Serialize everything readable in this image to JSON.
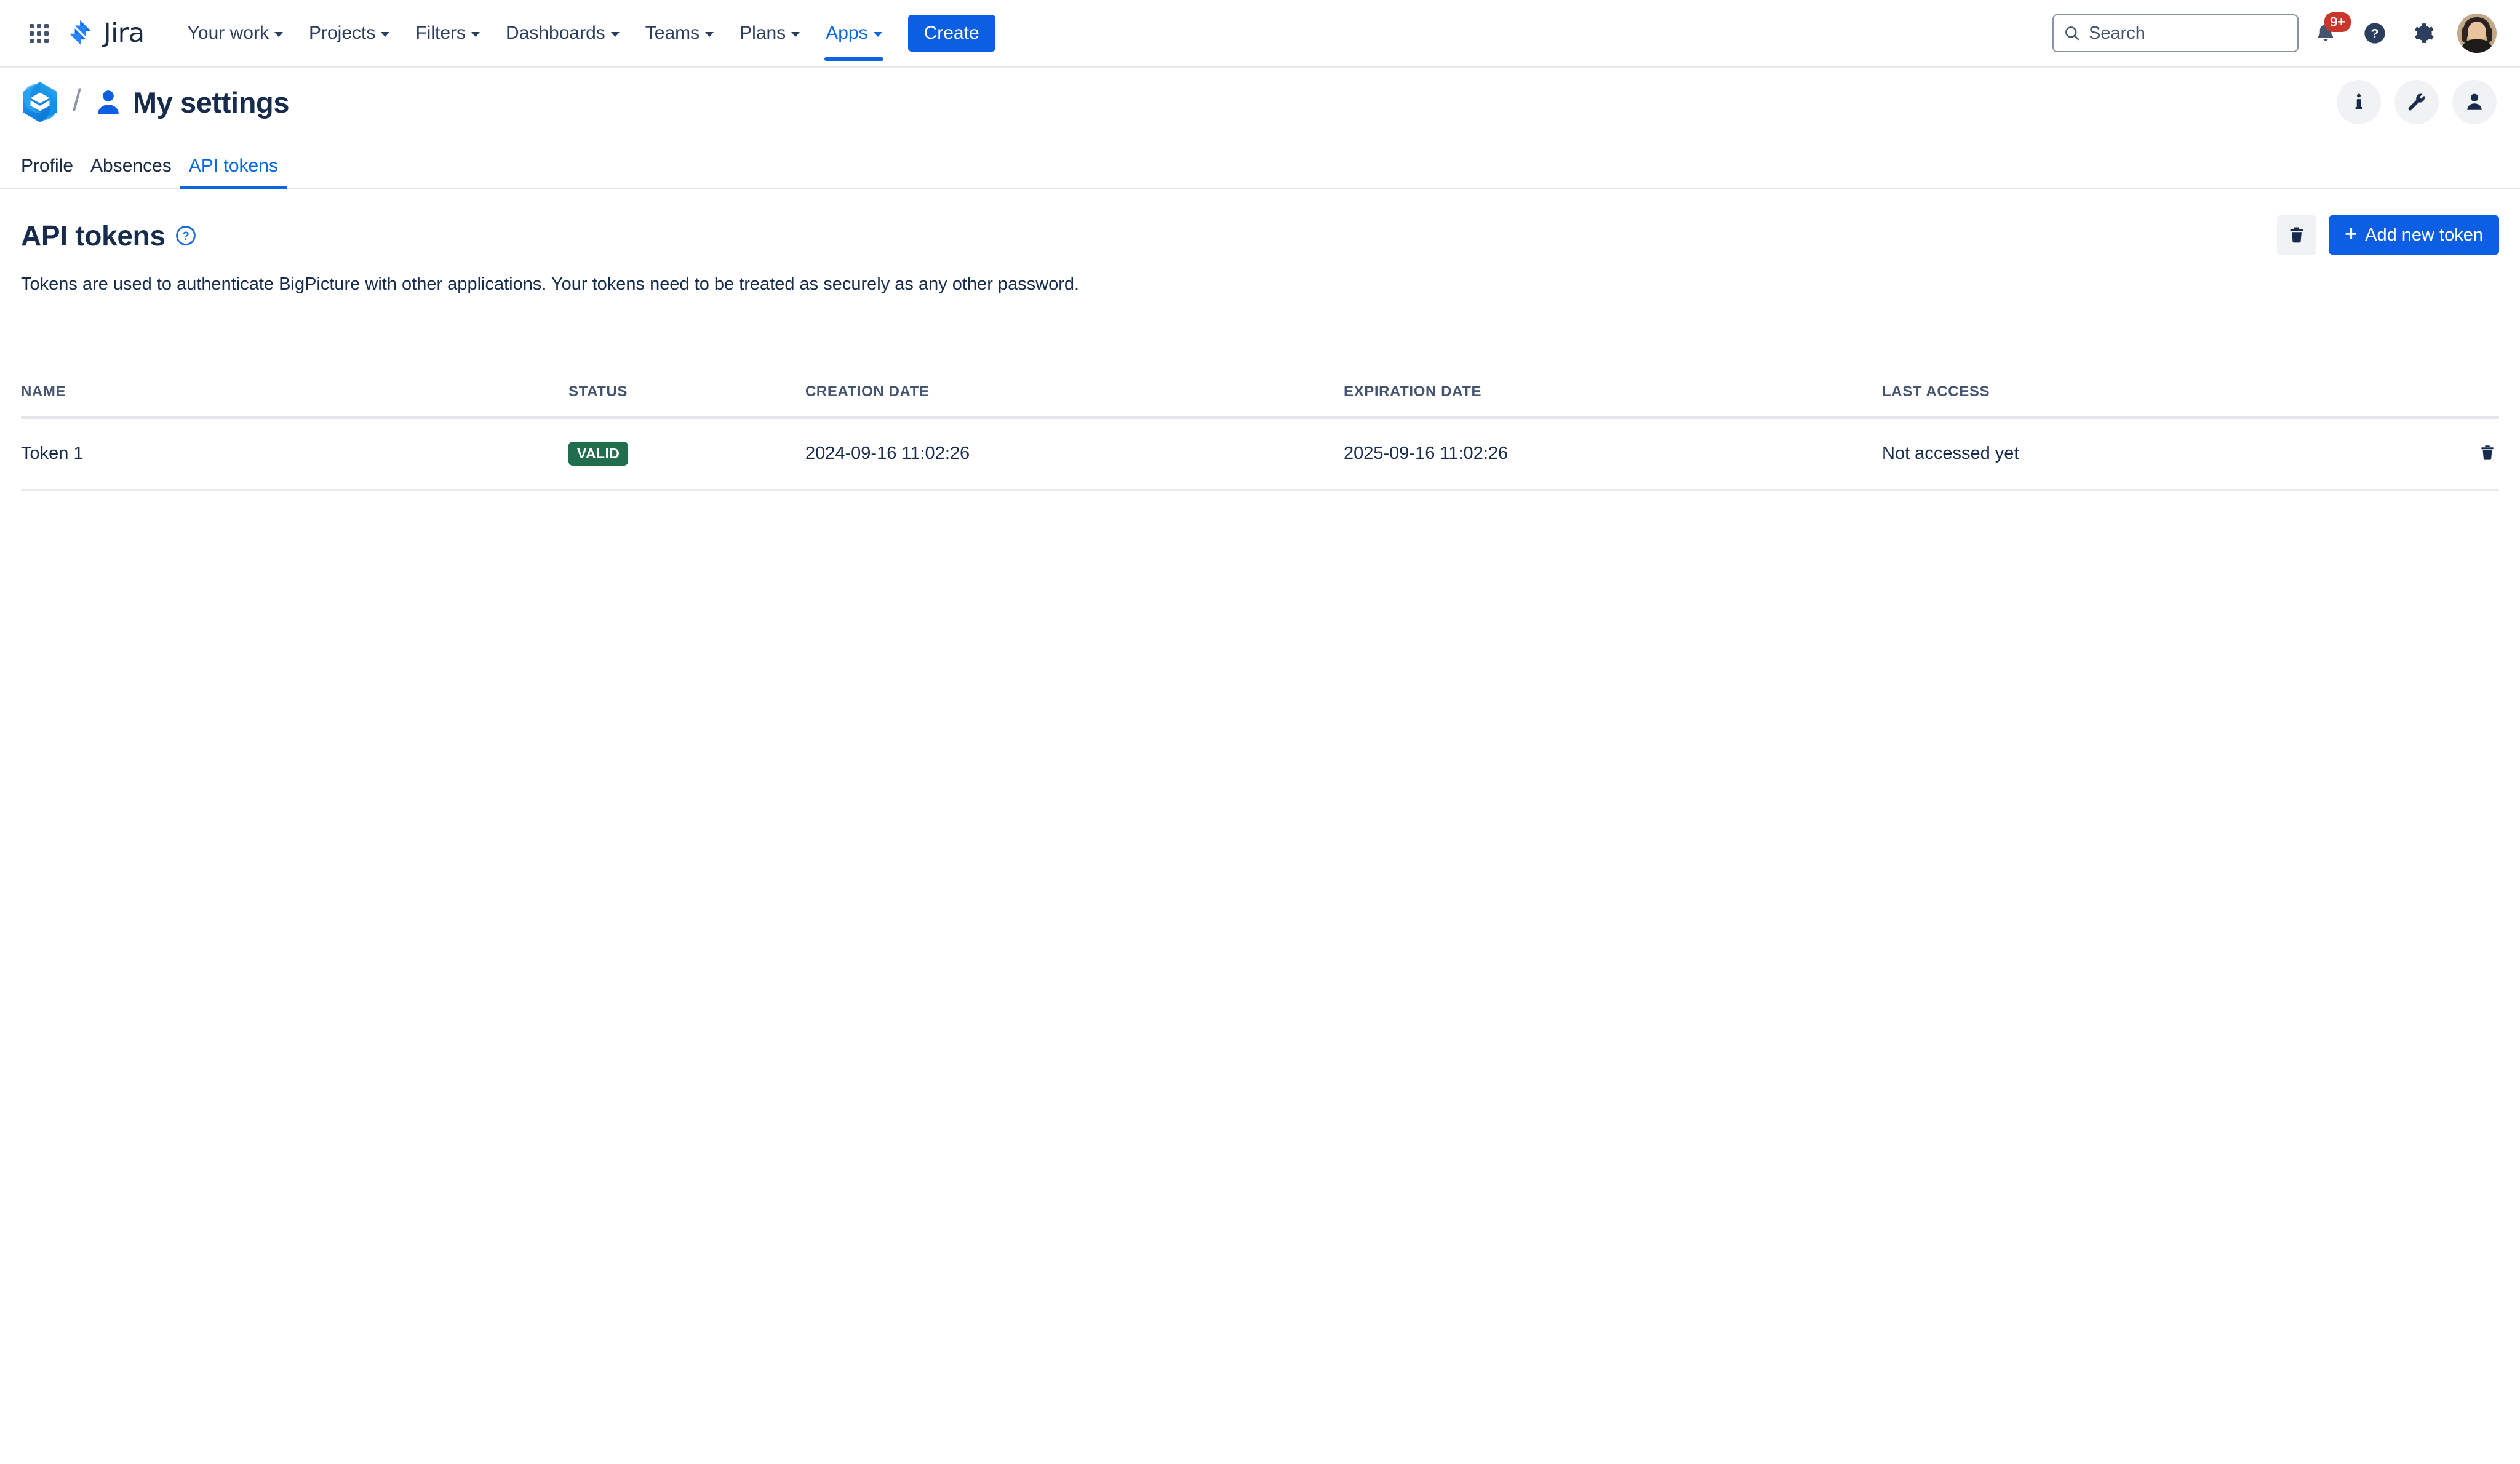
{
  "jira_nav": {
    "app_switcher": "app-switcher-icon",
    "logo_text": "Jira",
    "items": [
      {
        "label": "Your work",
        "active": false
      },
      {
        "label": "Projects",
        "active": false
      },
      {
        "label": "Filters",
        "active": false
      },
      {
        "label": "Dashboards",
        "active": false
      },
      {
        "label": "Teams",
        "active": false
      },
      {
        "label": "Plans",
        "active": false
      },
      {
        "label": "Apps",
        "active": true
      }
    ],
    "create_label": "Create",
    "search": {
      "placeholder": "Search",
      "value": ""
    },
    "notification_count": "9+",
    "accent_blue": "#0C66E4",
    "badge_red": "#C9372C"
  },
  "page_header": {
    "breadcrumb_separator": "/",
    "title": "My settings",
    "actions": [
      {
        "name": "info-button",
        "icon": "info-icon"
      },
      {
        "name": "tools-button",
        "icon": "wrench-icon"
      },
      {
        "name": "account-button",
        "icon": "person-icon"
      }
    ]
  },
  "tabs": [
    {
      "label": "Profile",
      "active": false
    },
    {
      "label": "Absences",
      "active": false
    },
    {
      "label": "API tokens",
      "active": true
    }
  ],
  "section": {
    "title": "API tokens",
    "help_icon": "help-circle-icon",
    "description": "Tokens are used to authenticate BigPicture with other applications. Your tokens need to be treated as securely as any other password.",
    "delete_button_icon": "trash-icon",
    "add_button_label": "Add new token",
    "add_button_plus": "+"
  },
  "table": {
    "columns": [
      "NAME",
      "STATUS",
      "CREATION DATE",
      "EXPIRATION DATE",
      "LAST ACCESS"
    ],
    "rows": [
      {
        "name": "Token 1",
        "status": "VALID",
        "status_color": "#216E4E",
        "creation_date": "2024-09-16 11:02:26",
        "expiration_date": "2025-09-16 11:02:26",
        "last_access": "Not accessed yet",
        "row_action_icon": "trash-icon"
      }
    ]
  }
}
